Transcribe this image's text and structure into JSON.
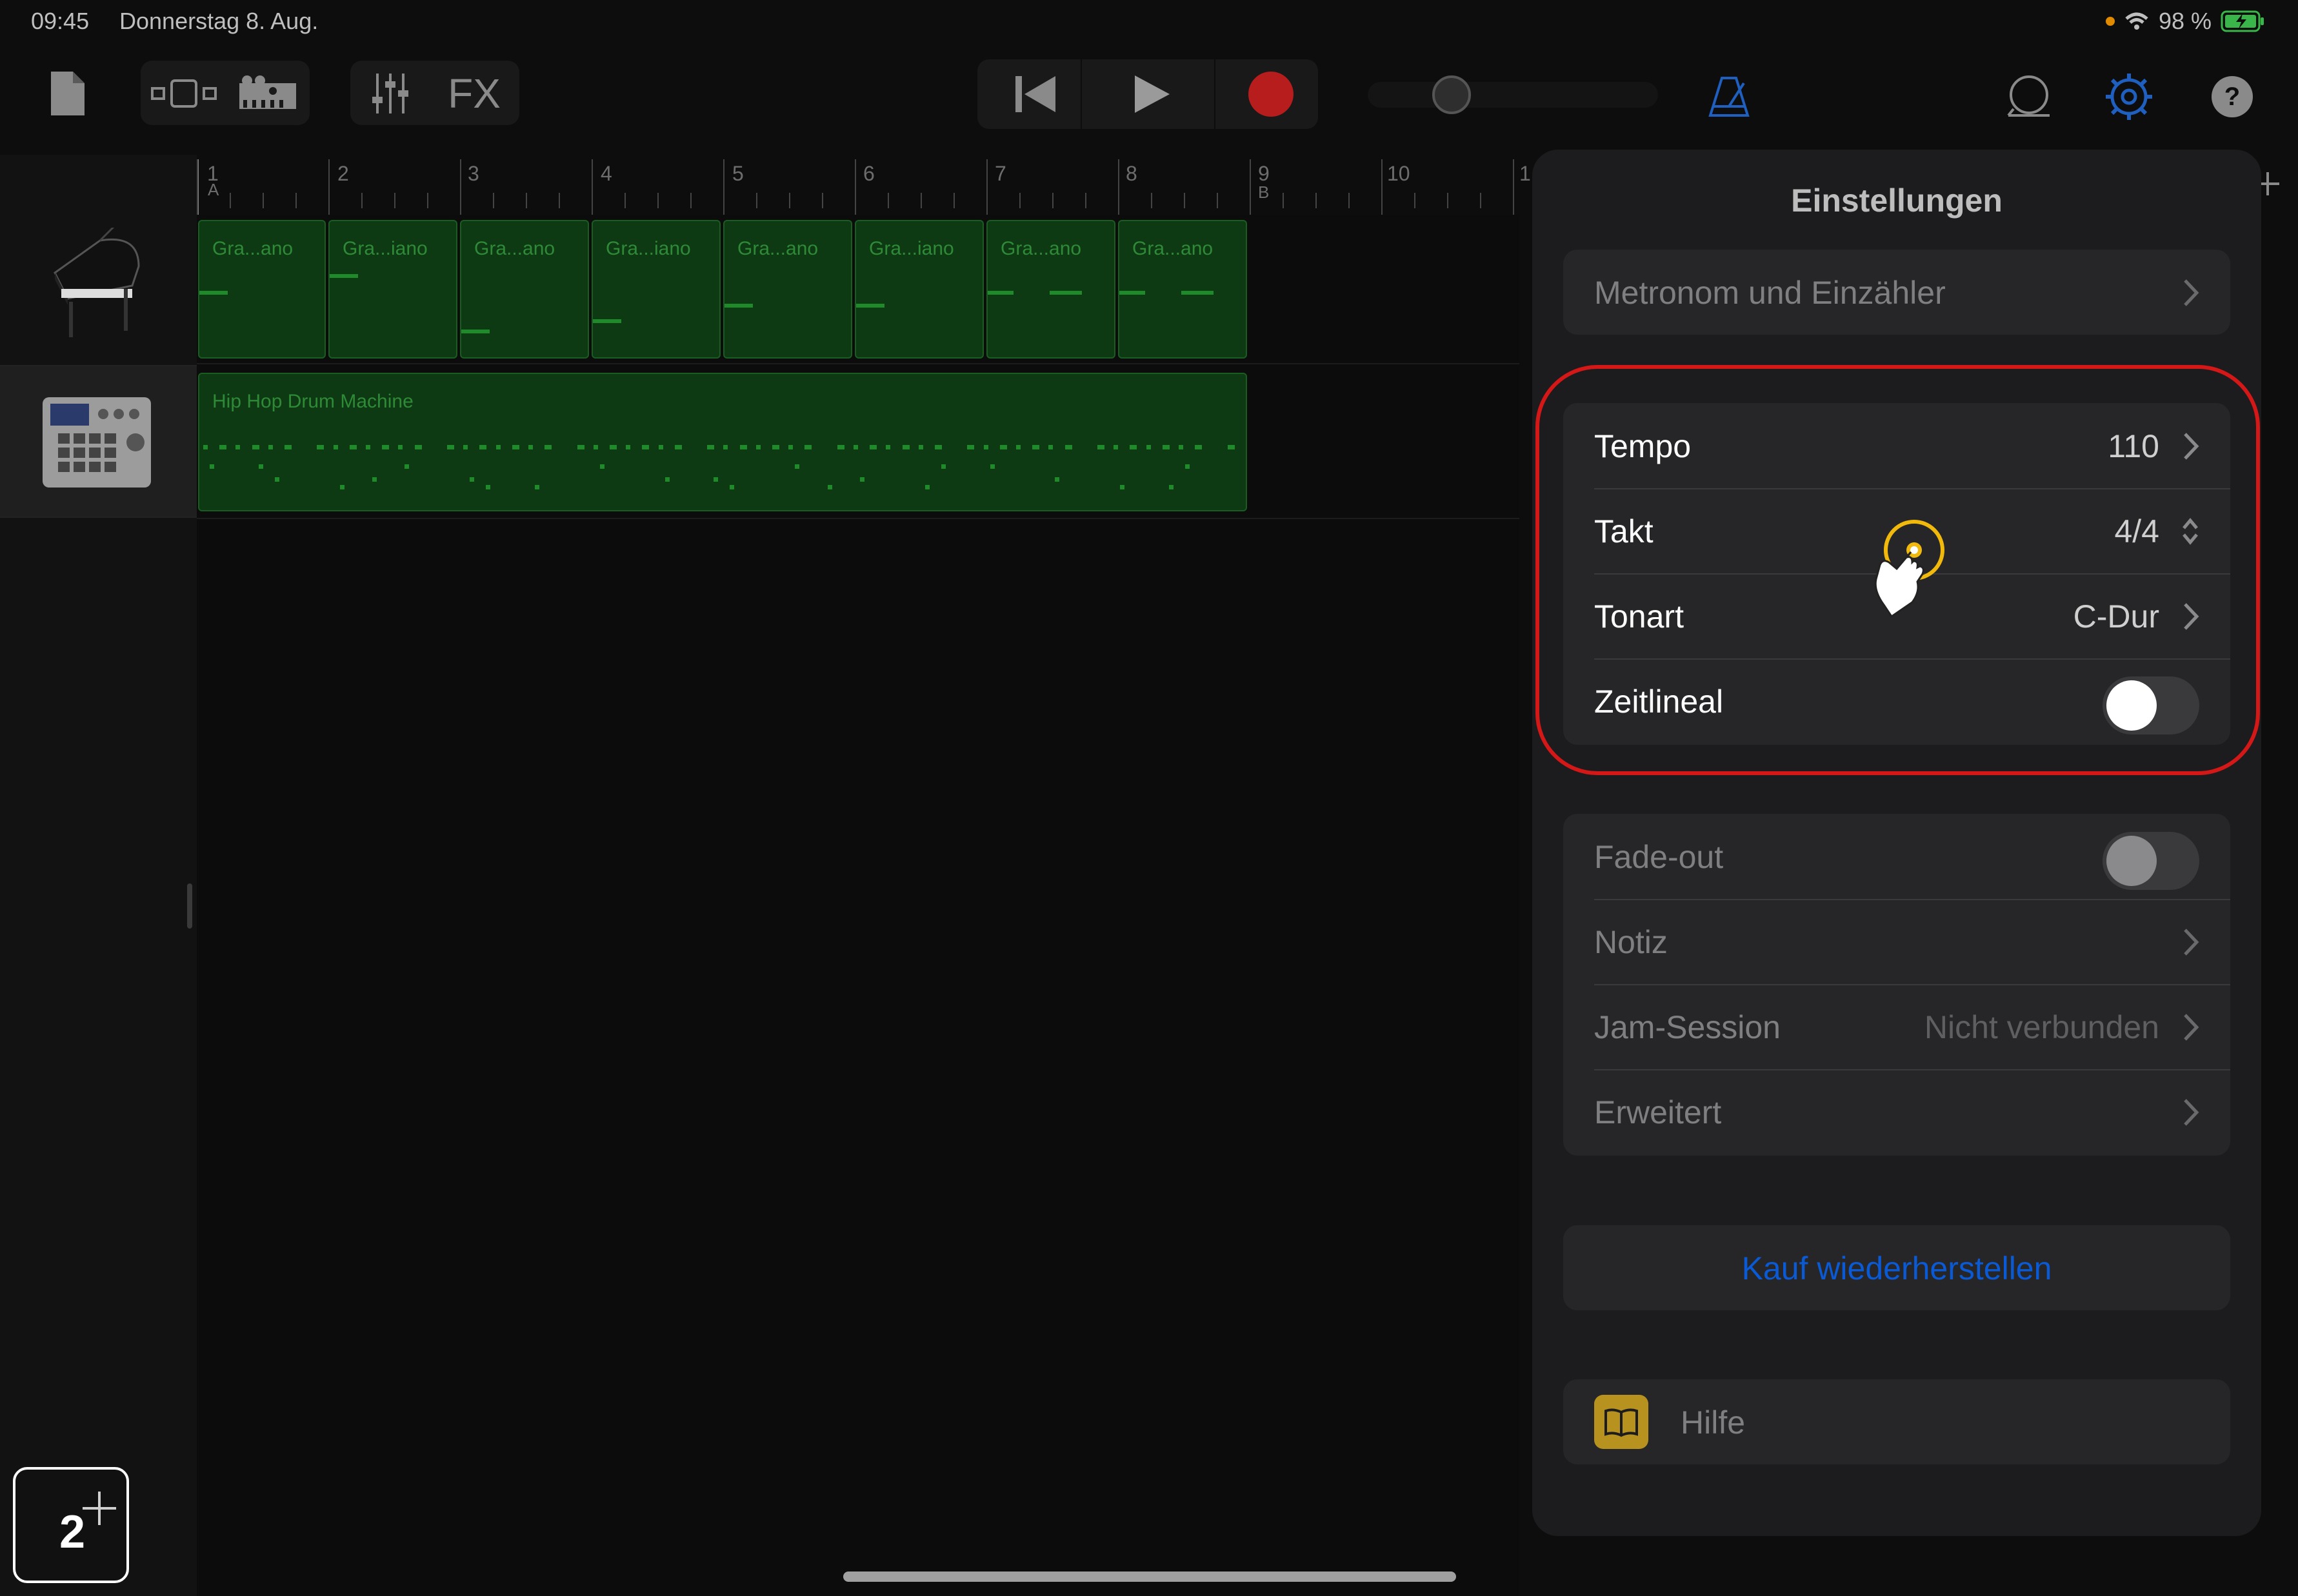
{
  "status": {
    "time": "09:45",
    "date": "Donnerstag 8. Aug.",
    "battery": "98 %"
  },
  "toolbar": {
    "fx_label": "FX"
  },
  "ruler": {
    "numbers": [
      "1",
      "2",
      "3",
      "4",
      "5",
      "6",
      "7",
      "8",
      "9",
      "10",
      "1"
    ],
    "marker_a": "A",
    "marker_b": "B"
  },
  "tracks": [
    {
      "name": "piano",
      "regions": [
        "Gra...ano",
        "Gra...iano",
        "Gra...ano",
        "Gra...iano",
        "Gra...ano",
        "Gra...iano",
        "Gra...ano",
        "Gra...ano"
      ]
    },
    {
      "name": "drums",
      "region_label": "Hip Hop Drum Machine"
    }
  ],
  "add_track": {
    "count": "2"
  },
  "settings": {
    "title": "Einstellungen",
    "metronome": "Metronom und Einzähler",
    "tempo_label": "Tempo",
    "tempo_value": "110",
    "takt_label": "Takt",
    "takt_value": "4/4",
    "tonart_label": "Tonart",
    "tonart_value": "C-Dur",
    "zeitlineal_label": "Zeitlineal",
    "fadeout_label": "Fade-out",
    "notiz_label": "Notiz",
    "jam_label": "Jam-Session",
    "jam_value": "Nicht verbunden",
    "erweitert_label": "Erweitert",
    "restore": "Kauf wiederherstellen",
    "help": "Hilfe"
  },
  "colors": {
    "accent_blue": "#0a5ad6",
    "region_green": "#0d3a12",
    "highlight_red": "#d41717",
    "record_red": "#b81d1d"
  }
}
